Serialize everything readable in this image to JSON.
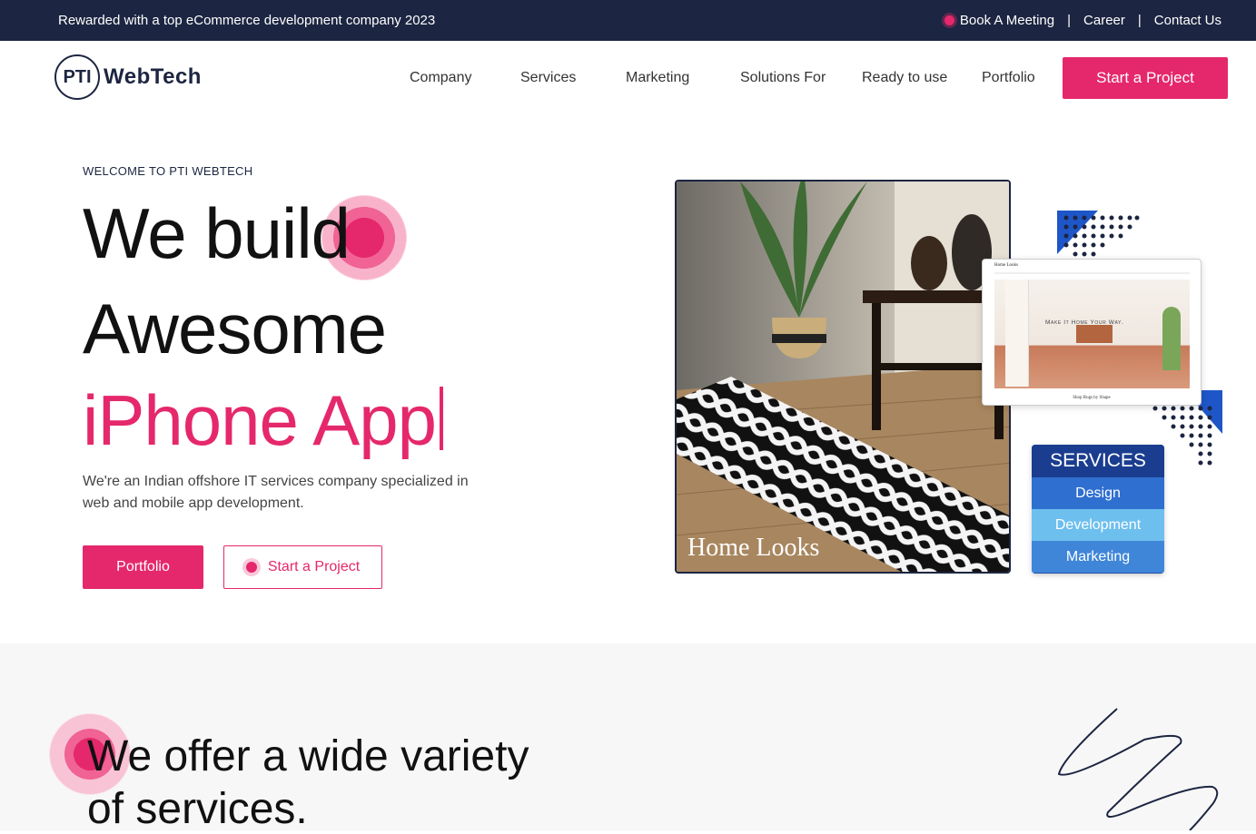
{
  "topbar": {
    "award": "Rewarded with a top eCommerce development company 2023",
    "book_meeting": "Book A Meeting",
    "career": "Career",
    "contact": "Contact Us",
    "separator": "|"
  },
  "logo": {
    "mark": "PTI",
    "name": "WebTech"
  },
  "nav": {
    "items": [
      "Company",
      "Services",
      "Marketing",
      "Solutions For",
      "Ready to use",
      "Portfolio"
    ],
    "cta": "Start a Project"
  },
  "hero": {
    "eyebrow": "WELCOME TO PTI WEBTECH",
    "line1": "We build",
    "line2": "Awesome",
    "line3": "iPhone App",
    "description": "We're an Indian offshore IT services company specialized in web and mobile app development.",
    "btn_portfolio": "Portfolio",
    "btn_start": "Start a Project",
    "photo_caption": "Home Looks"
  },
  "mockup": {
    "brand": "Home Looks",
    "tagline": "Make It Home Your Way.",
    "footer": "Shop Rugs by Shape"
  },
  "services_card": {
    "title": "SERVICES",
    "rows": [
      "Design",
      "Development",
      "Marketing"
    ]
  },
  "section2": {
    "line1": "We offer a wide variety",
    "line2": "of services."
  },
  "colors": {
    "accent": "#e5286b",
    "navy": "#1c2541"
  }
}
